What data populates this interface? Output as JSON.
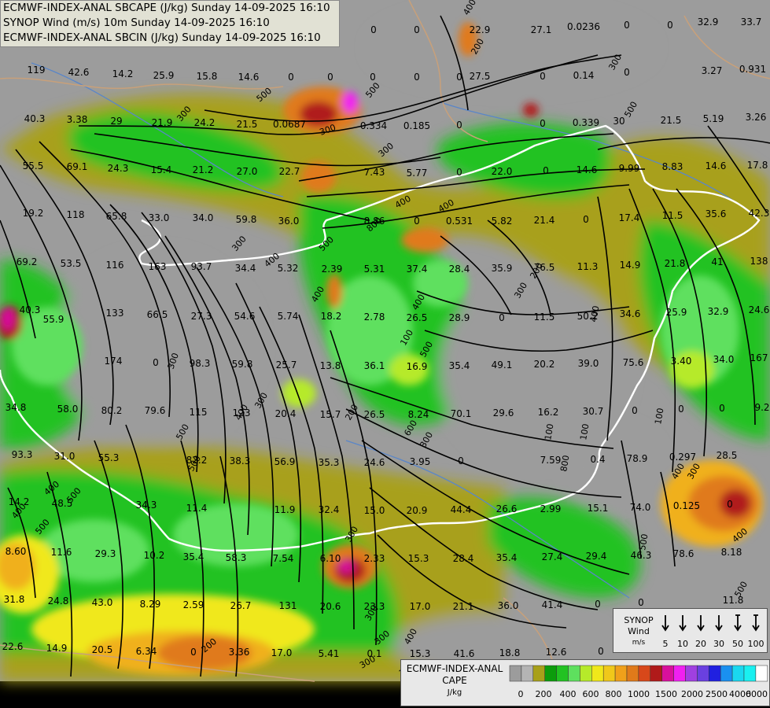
{
  "header": {
    "line1": "ECMWF-INDEX-ANAL SBCAPE (J/kg) Sunday 14-09-2025 16:10",
    "line2": "SYNOP Wind (m/s) 10m Sunday 14-09-2025 16:10",
    "line3": "ECMWF-INDEX-ANAL SBCIN (J/kg) Sunday 14-09-2025 16:10"
  },
  "colors": {
    "background_gray": "#9c9c9c",
    "olive": "#a8a01a",
    "dark_green": "#0c9c0c",
    "green": "#22c222",
    "light_green": "#5ee05e",
    "yellow_green": "#b6ea2a",
    "yellow": "#f0e81a",
    "orange": "#f0b01a",
    "dark_orange": "#e07a1a",
    "red_orange": "#d8481a",
    "dark_red": "#b01a1a",
    "magenta": "#d8109c",
    "pink": "#f020f0",
    "border_white": "#ffffff",
    "streamline": "#000000",
    "river": "#5a86c8",
    "country_line": "#c8a07a"
  },
  "station_values": [
    {
      "v": "0"
    },
    {
      "v": "0"
    },
    {
      "v": "22.9"
    },
    {
      "v": "27.1"
    },
    {
      "v": "0.0236"
    },
    {
      "v": "0"
    },
    {
      "v": "0"
    },
    {
      "v": "32.9"
    },
    {
      "v": "33.7"
    },
    {
      "v": "119"
    },
    {
      "v": "42.6"
    },
    {
      "v": "14.2"
    },
    {
      "v": "25.9"
    },
    {
      "v": "15.8"
    },
    {
      "v": "14.6"
    },
    {
      "v": "0"
    },
    {
      "v": "0"
    },
    {
      "v": "0"
    },
    {
      "v": "0"
    },
    {
      "v": "0"
    },
    {
      "v": "27.5"
    },
    {
      "v": "0"
    },
    {
      "v": "0.14"
    },
    {
      "v": "0"
    },
    {
      "v": "3.27"
    },
    {
      "v": "0.931"
    },
    {
      "v": "40.3"
    },
    {
      "v": "3.38"
    },
    {
      "v": "29"
    },
    {
      "v": "21.9"
    },
    {
      "v": "24.2"
    },
    {
      "v": "21.5"
    },
    {
      "v": "0.0687"
    },
    {
      "v": "0.334"
    },
    {
      "v": "0.185"
    },
    {
      "v": "0"
    },
    {
      "v": "0"
    },
    {
      "v": "0.339"
    },
    {
      "v": "30"
    },
    {
      "v": "21.5"
    },
    {
      "v": "5.19"
    },
    {
      "v": "3.26"
    },
    {
      "v": "55.5"
    },
    {
      "v": "69.1"
    },
    {
      "v": "24.3"
    },
    {
      "v": "15.4"
    },
    {
      "v": "21.2"
    },
    {
      "v": "27.0"
    },
    {
      "v": "22.7"
    },
    {
      "v": "7.43"
    },
    {
      "v": "5.77"
    },
    {
      "v": "0"
    },
    {
      "v": "22.0"
    },
    {
      "v": "0"
    },
    {
      "v": "14.6"
    },
    {
      "v": "9.99"
    },
    {
      "v": "8.83"
    },
    {
      "v": "14.6"
    },
    {
      "v": "17.8"
    },
    {
      "v": "19.2"
    },
    {
      "v": "118"
    },
    {
      "v": "65.8"
    },
    {
      "v": "33.0"
    },
    {
      "v": "34.0"
    },
    {
      "v": "59.8"
    },
    {
      "v": "36.0"
    },
    {
      "v": "8.86"
    },
    {
      "v": "0"
    },
    {
      "v": "0.531"
    },
    {
      "v": "5.82"
    },
    {
      "v": "21.4"
    },
    {
      "v": "0"
    },
    {
      "v": "17.4"
    },
    {
      "v": "11.5"
    },
    {
      "v": "35.6"
    },
    {
      "v": "42.3"
    },
    {
      "v": "69.2"
    },
    {
      "v": "53.5"
    },
    {
      "v": "116"
    },
    {
      "v": "163"
    },
    {
      "v": "93.7"
    },
    {
      "v": "34.4"
    },
    {
      "v": "5.32"
    },
    {
      "v": "2.39"
    },
    {
      "v": "5.31"
    },
    {
      "v": "37.4"
    },
    {
      "v": "28.4"
    },
    {
      "v": "35.9"
    },
    {
      "v": "76.5"
    },
    {
      "v": "11.3"
    },
    {
      "v": "14.9"
    },
    {
      "v": "21.8"
    },
    {
      "v": "41"
    },
    {
      "v": "138"
    },
    {
      "v": "40.3"
    },
    {
      "v": "55.9"
    },
    {
      "v": "133"
    },
    {
      "v": "66.5"
    },
    {
      "v": "27.3"
    },
    {
      "v": "54.6"
    },
    {
      "v": "5.74"
    },
    {
      "v": "18.2"
    },
    {
      "v": "2.78"
    },
    {
      "v": "26.5"
    },
    {
      "v": "28.9"
    },
    {
      "v": "0"
    },
    {
      "v": "11.5"
    },
    {
      "v": "50.2"
    },
    {
      "v": "34.6"
    },
    {
      "v": "25.9"
    },
    {
      "v": "32.9"
    },
    {
      "v": "24.6"
    },
    {
      "v": "174"
    },
    {
      "v": "0"
    },
    {
      "v": "98.3"
    },
    {
      "v": "59.8"
    },
    {
      "v": "25.7"
    },
    {
      "v": "13.8"
    },
    {
      "v": "36.1"
    },
    {
      "v": "16.9"
    },
    {
      "v": "35.4"
    },
    {
      "v": "49.1"
    },
    {
      "v": "20.2"
    },
    {
      "v": "39.0"
    },
    {
      "v": "75.6"
    },
    {
      "v": "3.40"
    },
    {
      "v": "34.0"
    },
    {
      "v": "167"
    },
    {
      "v": "34.8"
    },
    {
      "v": "58.0"
    },
    {
      "v": "80.2"
    },
    {
      "v": "79.6"
    },
    {
      "v": "115"
    },
    {
      "v": "123"
    },
    {
      "v": "20.4"
    },
    {
      "v": "15.7"
    },
    {
      "v": "26.5"
    },
    {
      "v": "8.24"
    },
    {
      "v": "70.1"
    },
    {
      "v": "29.6"
    },
    {
      "v": "16.2"
    },
    {
      "v": "30.7"
    },
    {
      "v": "0"
    },
    {
      "v": "0"
    },
    {
      "v": "0"
    },
    {
      "v": "9.2"
    },
    {
      "v": "93.3"
    },
    {
      "v": "31.0"
    },
    {
      "v": "55.3"
    },
    {
      "v": "82.2"
    },
    {
      "v": "38.3"
    },
    {
      "v": "56.9"
    },
    {
      "v": "35.3"
    },
    {
      "v": "24.6"
    },
    {
      "v": "3.95"
    },
    {
      "v": "0"
    },
    {
      "v": "7.59"
    },
    {
      "v": "0.4"
    },
    {
      "v": "78.9"
    },
    {
      "v": "0.297"
    },
    {
      "v": "28.5"
    },
    {
      "v": "14.2"
    },
    {
      "v": "48.5"
    },
    {
      "v": "34.3"
    },
    {
      "v": "11.4"
    },
    {
      "v": "11.9"
    },
    {
      "v": "32.4"
    },
    {
      "v": "15.0"
    },
    {
      "v": "20.9"
    },
    {
      "v": "44.4"
    },
    {
      "v": "26.6"
    },
    {
      "v": "2.99"
    },
    {
      "v": "15.1"
    },
    {
      "v": "74.0"
    },
    {
      "v": "0.125"
    },
    {
      "v": "0"
    },
    {
      "v": "8.60"
    },
    {
      "v": "11.6"
    },
    {
      "v": "29.3"
    },
    {
      "v": "10.2"
    },
    {
      "v": "35.4"
    },
    {
      "v": "58.3"
    },
    {
      "v": "7.54"
    },
    {
      "v": "6.10"
    },
    {
      "v": "2.33"
    },
    {
      "v": "15.3"
    },
    {
      "v": "28.4"
    },
    {
      "v": "35.4"
    },
    {
      "v": "27.4"
    },
    {
      "v": "29.4"
    },
    {
      "v": "46.3"
    },
    {
      "v": "78.6"
    },
    {
      "v": "8.18"
    },
    {
      "v": "31.8"
    },
    {
      "v": "24.8"
    },
    {
      "v": "43.0"
    },
    {
      "v": "8.29"
    },
    {
      "v": "2.59"
    },
    {
      "v": "26.7"
    },
    {
      "v": "131"
    },
    {
      "v": "20.6"
    },
    {
      "v": "23.3"
    },
    {
      "v": "17.0"
    },
    {
      "v": "21.1"
    },
    {
      "v": "36.0"
    },
    {
      "v": "41.4"
    },
    {
      "v": "0"
    },
    {
      "v": "0"
    },
    {
      "v": "11.8"
    },
    {
      "v": "22.6"
    },
    {
      "v": "14.9"
    },
    {
      "v": "20.5"
    },
    {
      "v": "6.34"
    },
    {
      "v": "0"
    },
    {
      "v": "3.36"
    },
    {
      "v": "17.0"
    },
    {
      "v": "5.41"
    },
    {
      "v": "0.1"
    },
    {
      "v": "15.3"
    },
    {
      "v": "41.6"
    },
    {
      "v": "18.8"
    },
    {
      "v": "12.6"
    },
    {
      "v": "0"
    }
  ],
  "cin_contours": [
    "500",
    "300",
    "300",
    "500",
    "300",
    "400",
    "800",
    "500",
    "400",
    "300",
    "400",
    "300",
    "500",
    "500",
    "400",
    "300",
    "200",
    "300",
    "300",
    "400",
    "300",
    "500",
    "300",
    "100",
    "300",
    "400",
    "200",
    "100",
    "500",
    "400",
    "300",
    "200",
    "400",
    "100",
    "600",
    "300",
    "300",
    "500",
    "100",
    "400",
    "300",
    "400",
    "500",
    "400",
    "500",
    "400",
    "500",
    "200",
    "400",
    "100",
    "800",
    "500"
  ],
  "synop_legend": {
    "label_line1": "SYNOP",
    "label_line2": "Wind",
    "label_line3": "m/s",
    "speeds": [
      "5",
      "10",
      "20",
      "30",
      "50",
      "100"
    ]
  },
  "cape_legend": {
    "title_line1": "ECMWF-INDEX-ANAL",
    "title_line2": "CAPE",
    "unit": "J/kg",
    "tick_labels": [
      "0",
      "200",
      "400",
      "600",
      "800",
      "1000",
      "1500",
      "2000",
      "2500",
      "4000",
      "6000"
    ],
    "swatch_colors": [
      "#9c9c9c",
      "#b4b4b4",
      "#a8a01a",
      "#0c9c0c",
      "#22c222",
      "#5ee05e",
      "#b6ea2a",
      "#f0e81a",
      "#f0c81a",
      "#f0a01a",
      "#e07a1a",
      "#d8481a",
      "#b01a1a",
      "#d8109c",
      "#f020f0",
      "#a040e0",
      "#6a40e0",
      "#2020e0",
      "#1a90f0",
      "#1ad8f0",
      "#1af0f0",
      "#ffffff"
    ]
  }
}
